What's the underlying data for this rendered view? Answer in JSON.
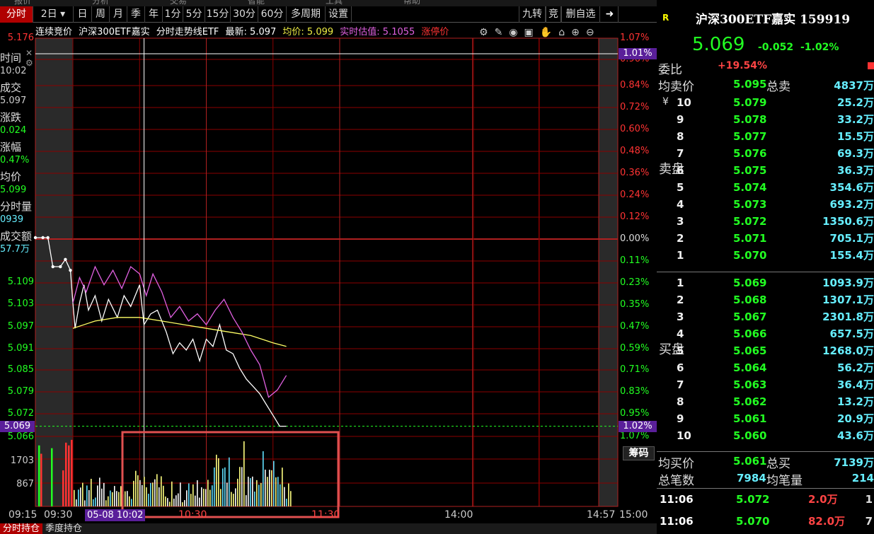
{
  "top_strip": {
    "items": [
      "报价",
      "分析",
      "交易",
      "智能",
      "工具",
      "帮助"
    ]
  },
  "toolbar": {
    "left_items": [
      {
        "label": "分时",
        "active": true,
        "w": 47
      },
      {
        "label": "2日 ▾",
        "w": 57
      },
      {
        "label": "日",
        "w": 26
      },
      {
        "label": "周",
        "w": 25
      },
      {
        "label": "月",
        "w": 25
      },
      {
        "label": "季",
        "w": 25
      },
      {
        "label": "年",
        "w": 25
      },
      {
        "label": "1分",
        "w": 29
      },
      {
        "label": "5分",
        "w": 31
      },
      {
        "label": "15分",
        "w": 36
      },
      {
        "label": "30分",
        "w": 39
      },
      {
        "label": "60分",
        "w": 40
      },
      {
        "label": "多周期",
        "w": 55
      },
      {
        "label": "设置",
        "w": 37
      }
    ],
    "right_items": [
      "九转",
      "竞",
      "删自选"
    ]
  },
  "info_line": {
    "status": "连续竞价",
    "name": "沪深300ETF嘉实",
    "indicator": "分时走势线ETF",
    "latest": "最新: 5.097",
    "avg": "均价: 5.099",
    "estimate": "实时估值: 5.1055",
    "limit": "涨停价"
  },
  "left_panel": [
    {
      "label": "时间",
      "value": "10:02",
      "color": "#ccc"
    },
    {
      "label": "成交",
      "value": "5.097",
      "color": "#ccc"
    },
    {
      "label": "涨跌",
      "value": "0.024",
      "color": "#2f2"
    },
    {
      "label": "涨幅",
      "value": "0.47%",
      "color": "#2f2"
    },
    {
      "label": "均价",
      "value": "5.099",
      "color": "#2f2"
    },
    {
      "label": "分时量",
      "value": "0939",
      "color": "#6ef"
    },
    {
      "label": "成交额",
      "value": "57.7万",
      "color": "#6ef"
    }
  ],
  "y_left": [
    {
      "text": "5.176",
      "y": 54,
      "color": "#f33"
    },
    {
      "text": "5.109",
      "y": 399,
      "color": "#2f2"
    },
    {
      "text": "5.103",
      "y": 430,
      "color": "#2f2"
    },
    {
      "text": "5.097",
      "y": 462,
      "color": "#2f2"
    },
    {
      "text": "5.091",
      "y": 493,
      "color": "#2f2"
    },
    {
      "text": "5.085",
      "y": 523,
      "color": "#2f2"
    },
    {
      "text": "5.079",
      "y": 554,
      "color": "#2f2"
    },
    {
      "text": "5.072",
      "y": 585,
      "color": "#2f2"
    },
    {
      "text": "5.066",
      "y": 618,
      "color": "#2f2"
    }
  ],
  "current_price_tag": "5.069",
  "y_right": [
    {
      "text": "1.07%",
      "y": 54,
      "color": "#f33"
    },
    {
      "text": "0.96%",
      "y": 84,
      "color": "#f33"
    },
    {
      "text": "0.84%",
      "y": 121,
      "color": "#f33"
    },
    {
      "text": "0.72%",
      "y": 152,
      "color": "#f33"
    },
    {
      "text": "0.60%",
      "y": 183,
      "color": "#f33"
    },
    {
      "text": "0.48%",
      "y": 214,
      "color": "#f33"
    },
    {
      "text": "0.36%",
      "y": 245,
      "color": "#f33"
    },
    {
      "text": "0.24%",
      "y": 276,
      "color": "#f33"
    },
    {
      "text": "0.12%",
      "y": 307,
      "color": "#f33"
    },
    {
      "text": "0.00%",
      "y": 338,
      "color": "#ddd"
    },
    {
      "text": "0.11%",
      "y": 369,
      "color": "#2f2"
    },
    {
      "text": "0.23%",
      "y": 400,
      "color": "#2f2"
    },
    {
      "text": "0.35%",
      "y": 431,
      "color": "#2f2"
    },
    {
      "text": "0.47%",
      "y": 462,
      "color": "#2f2"
    },
    {
      "text": "0.59%",
      "y": 493,
      "color": "#2f2"
    },
    {
      "text": "0.71%",
      "y": 523,
      "color": "#2f2"
    },
    {
      "text": "0.83%",
      "y": 554,
      "color": "#2f2"
    },
    {
      "text": "0.95%",
      "y": 585,
      "color": "#2f2"
    },
    {
      "text": "1.07%",
      "y": 617,
      "color": "#2f2"
    }
  ],
  "tag_top_right": "1.01%",
  "tag_bottom_right": "1.02%",
  "volume_axis": [
    "1703",
    "867"
  ],
  "x_axis": {
    "labels": [
      "09:15",
      "09:30",
      "10:30",
      "11:30",
      "14:00",
      "14:57",
      "15:00"
    ],
    "date_tag": "05-08 10:02"
  },
  "chip_button": "筹码",
  "bottom_tabs": [
    "分时持仓",
    "季度持仓"
  ],
  "quote": {
    "badge": "R",
    "title": "沪深300ETF嘉实 159919",
    "price": "5.069",
    "change": "-0.052",
    "change_pct": "-1.02%",
    "weibi_label": "委比",
    "weibi_value": "+19.54%",
    "sell_avg_label": "均卖价",
    "sell_avg": "5.095",
    "sell_total_label": "总卖",
    "sell_total": "4837万",
    "currency": "¥",
    "sell_side_label": "卖盘",
    "buy_side_label": "买盘",
    "sells": [
      {
        "lvl": "10",
        "price": "5.079",
        "vol": "25.2万"
      },
      {
        "lvl": "9",
        "price": "5.078",
        "vol": "33.2万"
      },
      {
        "lvl": "8",
        "price": "5.077",
        "vol": "15.5万"
      },
      {
        "lvl": "7",
        "price": "5.076",
        "vol": "69.3万"
      },
      {
        "lvl": "6",
        "price": "5.075",
        "vol": "36.3万"
      },
      {
        "lvl": "5",
        "price": "5.074",
        "vol": "354.6万"
      },
      {
        "lvl": "4",
        "price": "5.073",
        "vol": "693.2万"
      },
      {
        "lvl": "3",
        "price": "5.072",
        "vol": "1350.6万"
      },
      {
        "lvl": "2",
        "price": "5.071",
        "vol": "705.1万"
      },
      {
        "lvl": "1",
        "price": "5.070",
        "vol": "155.4万"
      }
    ],
    "buys": [
      {
        "lvl": "1",
        "price": "5.069",
        "vol": "1093.9万"
      },
      {
        "lvl": "2",
        "price": "5.068",
        "vol": "1307.1万"
      },
      {
        "lvl": "3",
        "price": "5.067",
        "vol": "2301.8万"
      },
      {
        "lvl": "4",
        "price": "5.066",
        "vol": "657.5万"
      },
      {
        "lvl": "5",
        "price": "5.065",
        "vol": "1268.0万"
      },
      {
        "lvl": "6",
        "price": "5.064",
        "vol": "56.2万"
      },
      {
        "lvl": "7",
        "price": "5.063",
        "vol": "36.4万"
      },
      {
        "lvl": "8",
        "price": "5.062",
        "vol": "13.2万"
      },
      {
        "lvl": "9",
        "price": "5.061",
        "vol": "20.9万"
      },
      {
        "lvl": "10",
        "price": "5.060",
        "vol": "43.6万"
      }
    ],
    "buy_avg_label": "均买价",
    "buy_avg": "5.061",
    "buy_total_label": "总买",
    "buy_total": "7139万",
    "total_trades_label": "总笔数",
    "total_trades": "7984",
    "avg_per_trade_label": "均笔量",
    "avg_per_trade": "214",
    "ticks": [
      {
        "time": "11:06",
        "price": "5.072",
        "vol": "2.0万",
        "n": "1"
      },
      {
        "time": "11:06",
        "price": "5.070",
        "vol": "82.0万",
        "n": "7"
      }
    ]
  },
  "colors": {
    "grid": "#8b0000",
    "price_line": "#ffffff",
    "avg_line": "#ffff66",
    "estimate_line": "#e060e0",
    "highlight_box": "#e05050"
  },
  "chart_data": {
    "type": "line",
    "title": "沪深300ETF嘉实",
    "prev_close": 5.121,
    "ylim": [
      5.066,
      5.176
    ],
    "series": [
      {
        "name": "最新",
        "x": [
          "09:15",
          "09:18",
          "09:20",
          "09:22",
          "09:25",
          "09:27",
          "09:29",
          "09:30",
          "09:31",
          "09:33",
          "09:35",
          "09:37",
          "09:40",
          "09:43",
          "09:46",
          "09:50",
          "09:53",
          "09:56",
          "10:00",
          "10:02",
          "10:05",
          "10:08",
          "10:12",
          "10:15",
          "10:18",
          "10:21",
          "10:24",
          "10:27",
          "10:30",
          "10:33",
          "10:36",
          "10:39",
          "10:42",
          "10:45",
          "10:48",
          "10:51",
          "10:54",
          "10:57",
          "11:00",
          "11:03",
          "11:06"
        ],
        "values": [
          5.121,
          5.121,
          5.121,
          5.113,
          5.113,
          5.115,
          5.112,
          5.103,
          5.096,
          5.103,
          5.108,
          5.101,
          5.105,
          5.098,
          5.104,
          5.099,
          5.105,
          5.102,
          5.108,
          5.097,
          5.1,
          5.101,
          5.095,
          5.089,
          5.092,
          5.09,
          5.093,
          5.087,
          5.093,
          5.091,
          5.097,
          5.09,
          5.089,
          5.085,
          5.082,
          5.08,
          5.078,
          5.075,
          5.072,
          5.069,
          5.069
        ]
      },
      {
        "name": "均价",
        "x": [
          "09:30",
          "09:40",
          "09:50",
          "10:00",
          "10:10",
          "10:20",
          "10:30",
          "10:40",
          "10:50",
          "11:00",
          "11:06"
        ],
        "values": [
          5.096,
          5.098,
          5.099,
          5.099,
          5.098,
          5.097,
          5.096,
          5.095,
          5.094,
          5.092,
          5.091
        ]
      },
      {
        "name": "实时估值",
        "x": [
          "09:30",
          "09:33",
          "09:36",
          "09:40",
          "09:44",
          "09:48",
          "09:52",
          "09:56",
          "10:00",
          "10:03",
          "10:06",
          "10:10",
          "10:14",
          "10:18",
          "10:22",
          "10:26",
          "10:30",
          "10:34",
          "10:38",
          "10:42",
          "10:46",
          "10:50",
          "10:54",
          "10:58",
          "11:02",
          "11:06"
        ],
        "values": [
          5.103,
          5.11,
          5.106,
          5.113,
          5.108,
          5.112,
          5.107,
          5.113,
          5.111,
          5.105,
          5.111,
          5.106,
          5.099,
          5.102,
          5.098,
          5.1,
          5.097,
          5.101,
          5.104,
          5.099,
          5.095,
          5.09,
          5.086,
          5.077,
          5.079,
          5.083
        ]
      }
    ],
    "volume": {
      "ylim": [
        0,
        2500
      ],
      "ticks": [
        1703,
        867
      ]
    }
  }
}
